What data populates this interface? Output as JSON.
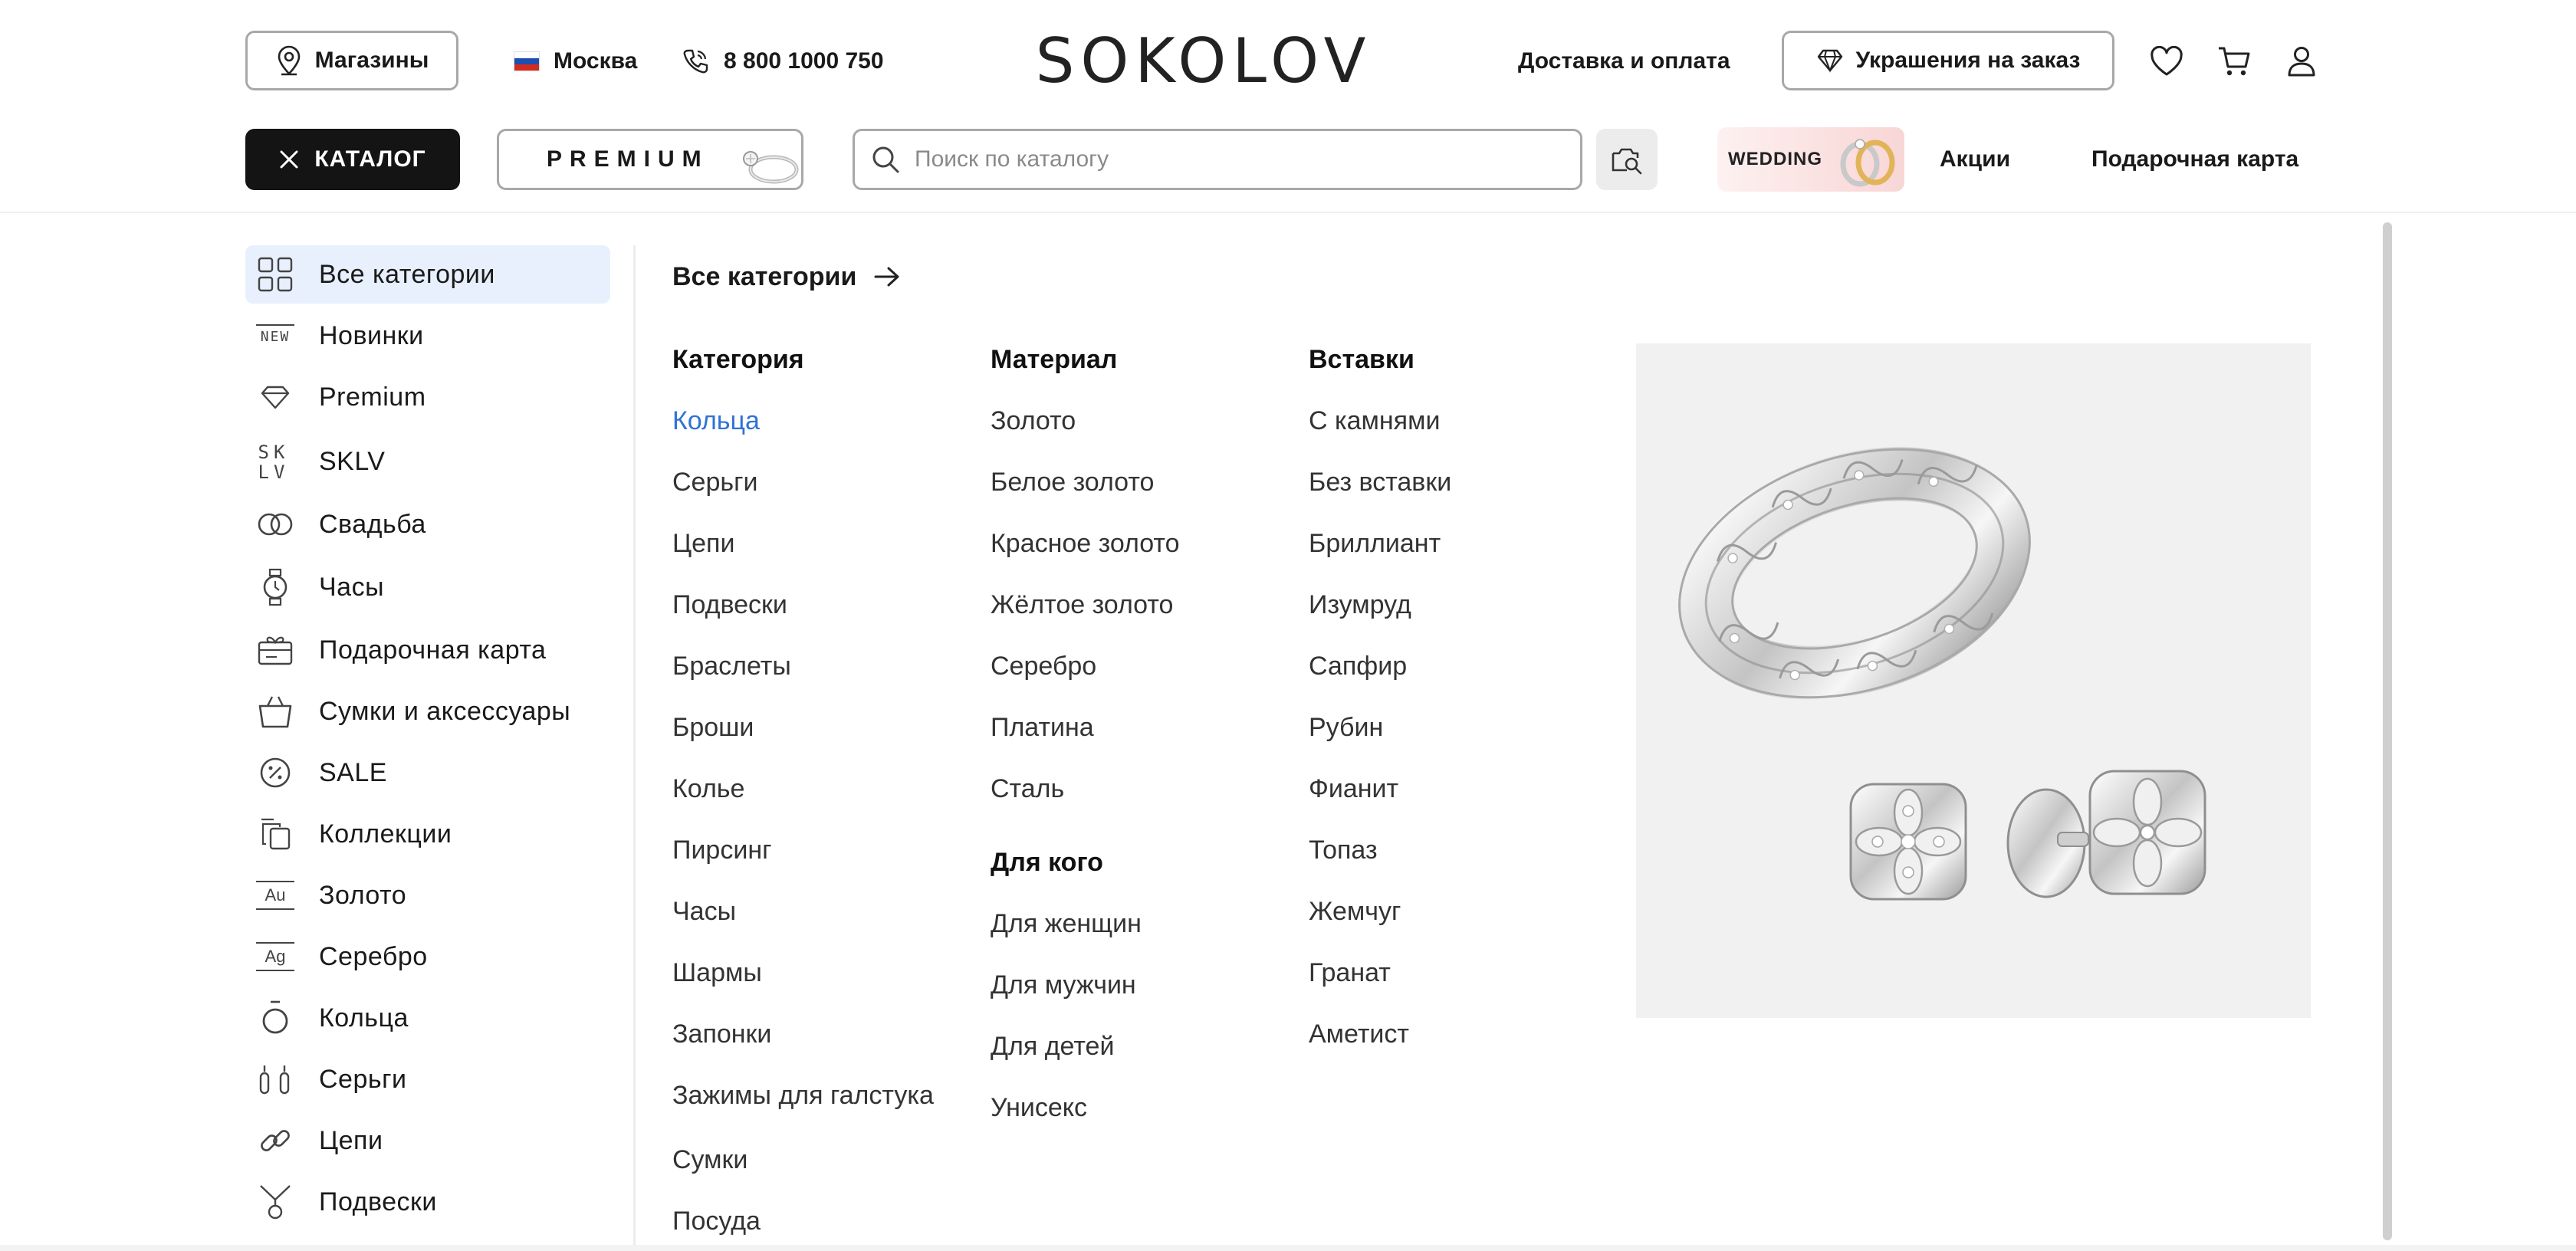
{
  "header": {
    "stores_label": "Магазины",
    "city_label": "Москва",
    "phone_label": "8 800 1000 750",
    "logo_text": "SOKOLOV",
    "delivery_label": "Доставка и оплата",
    "custom_jewelry_label": "Украшения на заказ",
    "catalog_label": "КАТАЛОГ",
    "premium_label": "PREMIUM",
    "search_placeholder": "Поиск по каталогу",
    "wedding_label": "WEDDING",
    "promotions_label": "Акции",
    "gift_card_label": "Подарочная карта",
    "icons": [
      "location-pin-icon",
      "russia-flag-icon",
      "phone-icon",
      "diamond-icon",
      "heart-icon",
      "cart-icon",
      "user-icon",
      "close-icon",
      "search-icon",
      "camera-search-icon"
    ]
  },
  "sidebar": {
    "items": [
      {
        "label": "Все категории",
        "icon": "grid-icon",
        "active": true
      },
      {
        "label": "Новинки",
        "icon": "new-badge-icon",
        "icon_text": "NEW"
      },
      {
        "label": "Premium",
        "icon": "diamond-icon"
      },
      {
        "label": "SKLV",
        "icon": "sklv-logo-icon",
        "icon_text": "SK LV"
      },
      {
        "label": "Свадьба",
        "icon": "wedding-rings-icon"
      },
      {
        "label": "Часы",
        "icon": "watch-icon"
      },
      {
        "label": "Подарочная карта",
        "icon": "gift-card-icon"
      },
      {
        "label": "Сумки и аксессуары",
        "icon": "bag-icon"
      },
      {
        "label": "SALE",
        "icon": "percent-icon"
      },
      {
        "label": "Коллекции",
        "icon": "collections-icon"
      },
      {
        "label": "Золото",
        "icon": "gold-au-icon",
        "icon_text": "Au"
      },
      {
        "label": "Серебро",
        "icon": "silver-ag-icon",
        "icon_text": "Ag"
      },
      {
        "label": "Кольца",
        "icon": "ring-icon"
      },
      {
        "label": "Серьги",
        "icon": "earrings-icon"
      },
      {
        "label": "Цепи",
        "icon": "chain-icon"
      },
      {
        "label": "Подвески",
        "icon": "pendant-icon"
      }
    ]
  },
  "menu": {
    "all_categories_label": "Все категории",
    "category": {
      "heading": "Категория",
      "items": [
        "Кольца",
        "Серьги",
        "Цепи",
        "Подвески",
        "Браслеты",
        "Броши",
        "Колье",
        "Пирсинг",
        "Часы",
        "Шармы",
        "Запонки",
        "Зажимы для галстука",
        "Сумки",
        "Посуда"
      ]
    },
    "material": {
      "heading": "Материал",
      "items": [
        "Золото",
        "Белое золото",
        "Красное золото",
        "Жёлтое золото",
        "Серебро",
        "Платина",
        "Сталь"
      ]
    },
    "for_whom": {
      "heading": "Для кого",
      "items": [
        "Для женщин",
        "Для мужчин",
        "Для детей",
        "Унисекс"
      ]
    },
    "inserts": {
      "heading": "Вставки",
      "items": [
        "С камнями",
        "Без вставки",
        "Бриллиант",
        "Изумруд",
        "Сапфир",
        "Рубин",
        "Фианит",
        "Топаз",
        "Жемчуг",
        "Гранат",
        "Аметист"
      ]
    }
  },
  "colors": {
    "accent_blue": "#2f73d4",
    "active_bg": "#e7f0fc",
    "catalog_bg": "#141414",
    "promo_bg": "#f1f1f1"
  }
}
